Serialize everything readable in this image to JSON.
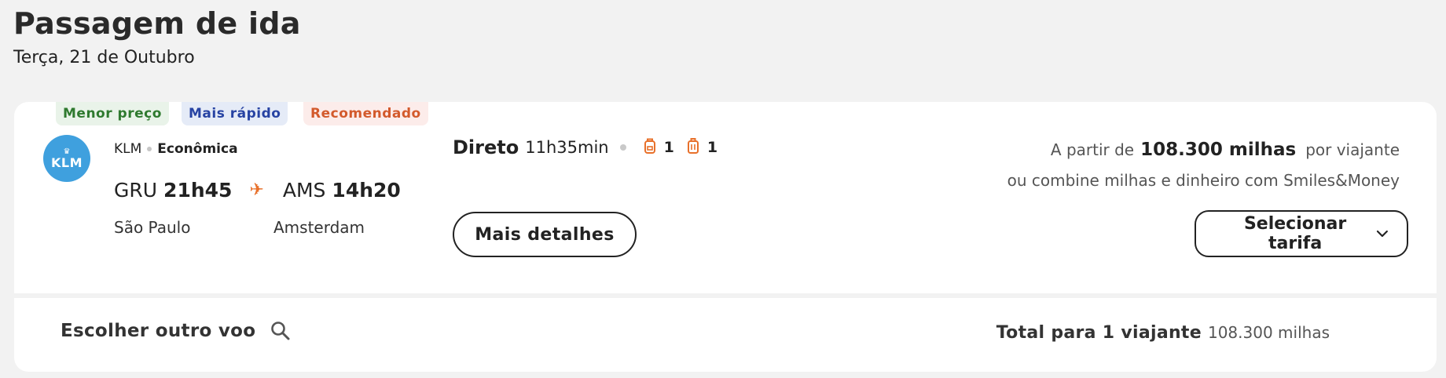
{
  "header": {
    "title": "Passagem de ida",
    "date": "Terça, 21 de Outubro"
  },
  "flight_card": {
    "tags": {
      "lowest_price": "Menor preço",
      "fastest": "Mais rápido",
      "recommended": "Recomendado"
    },
    "airline": {
      "logo_text": "KLM",
      "name": "KLM",
      "cabin": "Econômica"
    },
    "origin": {
      "code": "GRU",
      "time": "21h45",
      "city": "São Paulo"
    },
    "destination": {
      "code": "AMS",
      "time": "14h20",
      "city": "Amsterdam"
    },
    "info": {
      "stops": "Direto",
      "duration": "11h35min",
      "carry_on_count": "1",
      "checked_bag_count": "1"
    },
    "details_button": "Mais detalhes",
    "price": {
      "prefix": "A partir de",
      "amount": "108.300 milhas",
      "suffix": "por viajante",
      "combine_text": "ou combine milhas e dinheiro com Smiles&Money"
    },
    "select_button": "Selecionar tarifa",
    "footer": {
      "other_flight": "Escolher outro voo",
      "total_label": "Total para 1 viajante",
      "total_value": "108.300 milhas"
    }
  },
  "colors": {
    "accent": "#e8702a",
    "logo_bg": "#3fa0de",
    "tag_green": "#2f7a2f",
    "tag_blue": "#2743a3",
    "tag_orange": "#d35a2c"
  },
  "icons": {
    "plane": "plane-icon",
    "carry_on": "backpack-icon",
    "checked": "suitcase-icon",
    "search": "search-icon",
    "chevron": "chevron-down-icon"
  }
}
